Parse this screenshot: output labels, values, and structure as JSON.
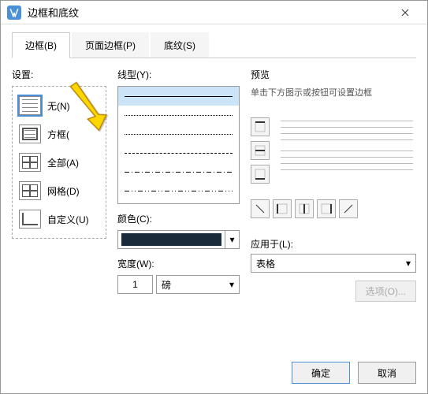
{
  "window": {
    "title": "边框和底纹"
  },
  "tabs": [
    {
      "label": "边框(B)",
      "active": true
    },
    {
      "label": "页面边框(P)",
      "active": false
    },
    {
      "label": "底纹(S)",
      "active": false
    }
  ],
  "settings": {
    "label": "设置:",
    "items": [
      {
        "key": "none",
        "label": "无(N)",
        "selected": true
      },
      {
        "key": "box",
        "label": "方框("
      },
      {
        "key": "all",
        "label": "全部(A)"
      },
      {
        "key": "grid",
        "label": "网格(D)"
      },
      {
        "key": "custom",
        "label": "自定义(U)"
      }
    ]
  },
  "linetype": {
    "label": "线型(Y):",
    "selected_index": 0
  },
  "color": {
    "label": "颜色(C):",
    "value": "#1a2b3c"
  },
  "width": {
    "label": "宽度(W):",
    "value": "1",
    "unit": "磅"
  },
  "preview": {
    "label": "预览",
    "hint": "单击下方图示或按钮可设置边框"
  },
  "applyto": {
    "label": "应用于(L):",
    "value": "表格"
  },
  "options_button": "选项(O)...",
  "footer": {
    "ok": "确定",
    "cancel": "取消"
  }
}
